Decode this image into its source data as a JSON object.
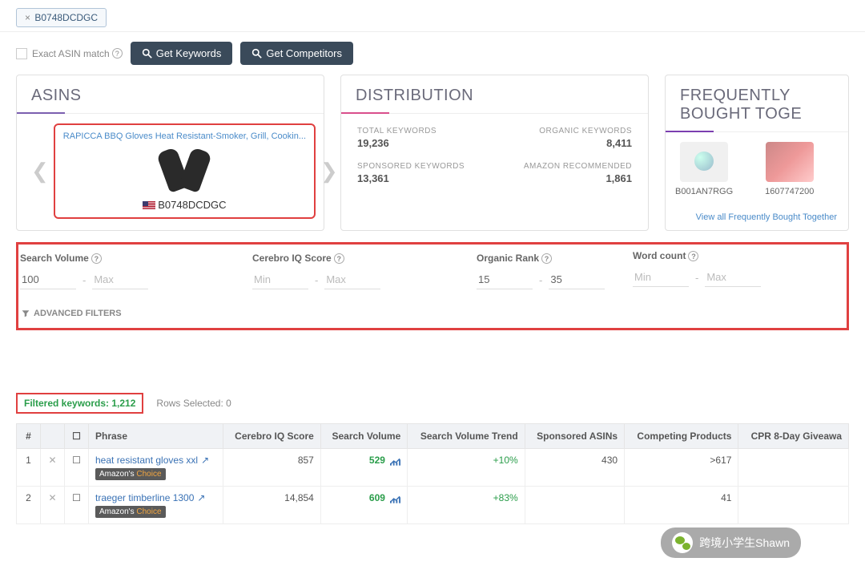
{
  "asin_chip": "B0748DCDGC",
  "exact_match_label": "Exact ASIN match",
  "btn_keywords": "Get Keywords",
  "btn_competitors": "Get Competitors",
  "panels": {
    "asins_title": "ASINS",
    "dist_title": "DISTRIBUTION",
    "freq_title": "FREQUENTLY BOUGHT TOGE"
  },
  "asin_card": {
    "title": "RAPICCA BBQ Gloves Heat Resistant-Smoker, Grill, Cookin...",
    "code": "B0748DCDGC"
  },
  "distribution": {
    "total_keywords_label": "TOTAL KEYWORDS",
    "total_keywords": "19,236",
    "sponsored_label": "SPONSORED KEYWORDS",
    "sponsored": "13,361",
    "organic_label": "ORGANIC KEYWORDS",
    "organic": "8,411",
    "amazon_rec_label": "AMAZON RECOMMENDED",
    "amazon_rec": "1,861"
  },
  "freq": {
    "item1": "B001AN7RGG",
    "item2": "1607747200",
    "link": "View all Frequently Bought Together"
  },
  "filters": {
    "search_volume_label": "Search Volume",
    "cerebro_iq_label": "Cerebro IQ Score",
    "organic_rank_label": "Organic Rank",
    "word_count_label": "Word count",
    "min_ph": "Min",
    "max_ph": "Max",
    "sv_min": "100",
    "or_min": "15",
    "or_max": "35",
    "advanced": "ADVANCED FILTERS"
  },
  "results": {
    "filtered_label": "Filtered keywords:",
    "filtered_count": "1,212",
    "rows_selected": "Rows Selected: 0",
    "columns": {
      "num": "#",
      "phrase": "Phrase",
      "iq": "Cerebro IQ Score",
      "sv": "Search Volume",
      "svt": "Search Volume Trend",
      "sa": "Sponsored ASINs",
      "cp": "Competing Products",
      "cpr": "CPR 8-Day Giveawa"
    },
    "rows": [
      {
        "n": "1",
        "phrase": "heat resistant gloves xxl",
        "iq": "857",
        "sv": "529",
        "svt": "+10%",
        "sa": "430",
        "cp": ">617",
        "badge": "Amazon's ",
        "badge2": "Choice"
      },
      {
        "n": "2",
        "phrase": "traeger timberline 1300",
        "iq": "14,854",
        "sv": "609",
        "svt": "+83%",
        "sa": "",
        "cp": "41",
        "badge": "Amazon's ",
        "badge2": "Choice"
      }
    ]
  },
  "overlay": "跨境小学生Shawn",
  "x_glyph": "×",
  "chk_glyph": "☐"
}
